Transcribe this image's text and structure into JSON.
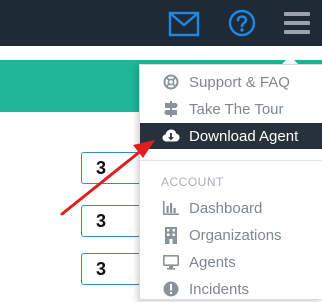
{
  "header": {
    "icons": {
      "mail": "mail-icon",
      "help": "help-icon",
      "menu": "hamburger-menu-icon"
    }
  },
  "inputs": [
    {
      "value": "3"
    },
    {
      "value": "3"
    },
    {
      "value": "3"
    }
  ],
  "menu": {
    "items": [
      {
        "label": "Support & FAQ",
        "icon": "lifebuoy-icon"
      },
      {
        "label": "Take The Tour",
        "icon": "signpost-icon"
      },
      {
        "label": "Download Agent",
        "icon": "cloud-download-icon",
        "active": true
      }
    ],
    "section_header": "ACCOUNT",
    "account_items": [
      {
        "label": "Dashboard",
        "icon": "bar-chart-icon"
      },
      {
        "label": "Organizations",
        "icon": "building-icon"
      },
      {
        "label": "Agents",
        "icon": "monitor-icon"
      },
      {
        "label": "Incidents",
        "icon": "alert-circle-icon"
      }
    ]
  },
  "colors": {
    "topbar": "#1e2a36",
    "accent_blue": "#1e88e5",
    "teal": "#1fb597",
    "menu_active_bg": "#27313b",
    "annotation_arrow": "#e02020"
  }
}
